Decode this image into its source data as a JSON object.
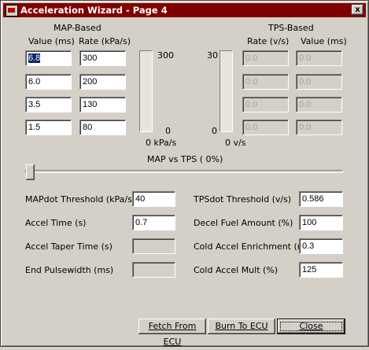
{
  "window": {
    "title": "Acceleration Wizard - Page 4",
    "close_glyph": "x"
  },
  "map": {
    "heading": "MAP-Based",
    "col_value": "Value (ms)",
    "col_rate": "Rate (kPa/s)",
    "values": [
      "6.8",
      "6.0",
      "3.5",
      "1.5"
    ],
    "rates": [
      "300",
      "200",
      "130",
      "80"
    ],
    "bar_max": "300",
    "bar_min": "0",
    "bar_unit": "0 kPa/s",
    "bar_level": 0
  },
  "tps": {
    "heading": "TPS-Based",
    "col_rate": "Rate (v/s)",
    "col_value": "Value (ms)",
    "rates": [
      "0.0",
      "0.0",
      "0.0",
      "0.0"
    ],
    "values": [
      "0.0",
      "0.0",
      "0.0",
      "0.0"
    ],
    "bar_max": "30",
    "bar_min": "0",
    "bar_unit": "0 v/s",
    "bar_level": 0
  },
  "slider": {
    "label": "MAP vs TPS (  0%)",
    "value_percent": 0
  },
  "fields": {
    "mapdot_threshold_label": "MAPdot Threshold (kPa/s)",
    "mapdot_threshold": "40",
    "accel_time_label": "Accel Time (s)",
    "accel_time": "0.7",
    "accel_taper_label": "Accel Taper Time (s)",
    "accel_taper": "",
    "end_pulsewidth_label": "End Pulsewidth (ms)",
    "end_pulsewidth": "",
    "tpsdot_threshold_label": "TPSdot Threshold (v/s)",
    "tpsdot_threshold": "0.586",
    "decel_fuel_label": "Decel Fuel Amount (%)",
    "decel_fuel": "100",
    "cold_accel_enrich_label": "Cold Accel Enrichment (ms)",
    "cold_accel_enrich": "0.3",
    "cold_accel_mult_label": "Cold Accel Mult (%)",
    "cold_accel_mult": "125"
  },
  "buttons": {
    "fetch": "Fetch From ECU",
    "burn": "Burn To ECU",
    "close": "Close"
  }
}
